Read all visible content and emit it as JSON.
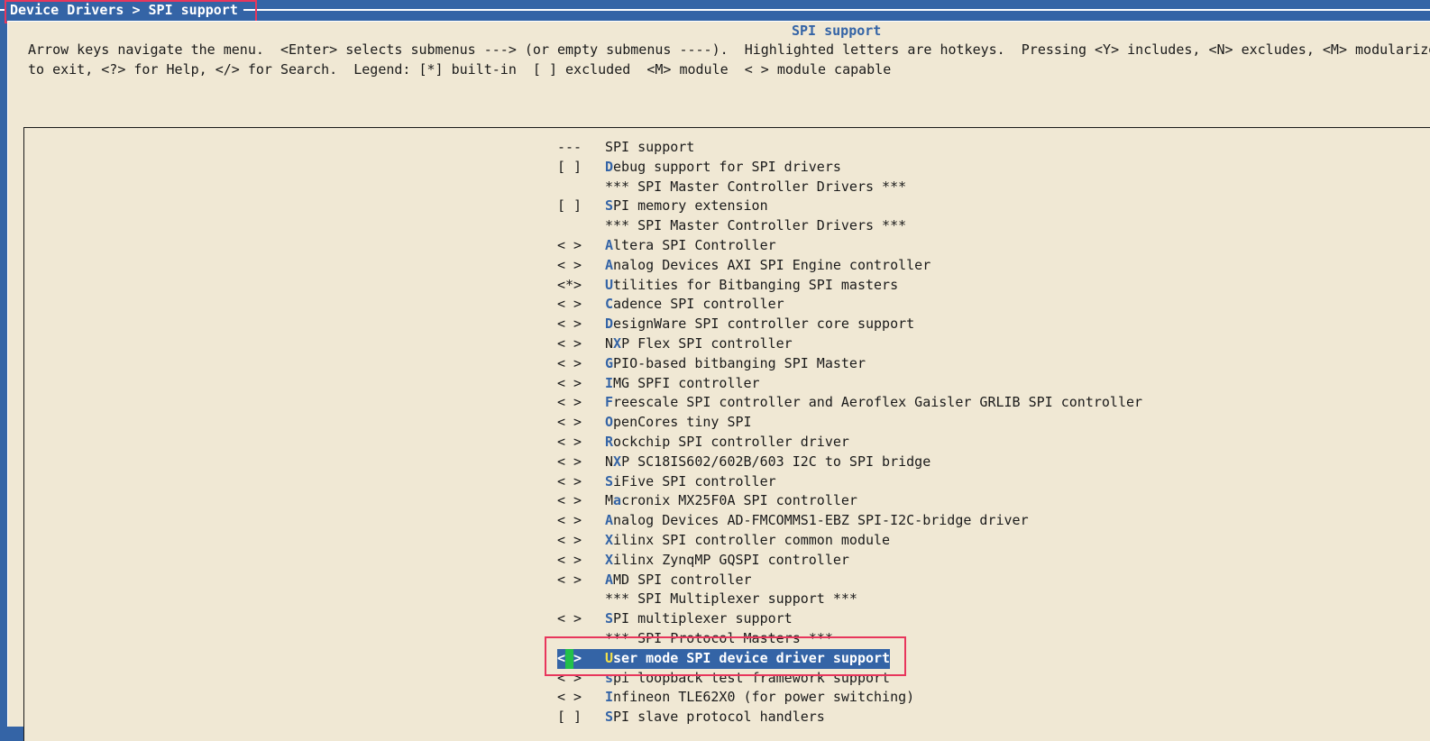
{
  "breadcrumb": "Device Drivers > SPI support",
  "panel_title": "SPI support",
  "help_lines": [
    "Arrow keys navigate the menu.  <Enter> selects submenus ---> (or empty submenus ----).  Highlighted letters are hotkeys.  Pressing <Y> includes, <N> excludes, <M> modularize",
    "to exit, <?> for Help, </> for Search.  Legend: [*] built-in  [ ] excluded  <M> module  < > module capable"
  ],
  "colors": {
    "blue": "#3464a6",
    "panel": "#f0e8d4",
    "highlight_border": "#e8365c"
  },
  "menu": [
    {
      "mark": "---",
      "hot": "",
      "rest": "SPI support"
    },
    {
      "mark": "[ ]",
      "hot": "D",
      "rest": "ebug support for SPI drivers"
    },
    {
      "mark": "",
      "hot": "",
      "rest": "*** SPI Master Controller Drivers ***"
    },
    {
      "mark": "[ ]",
      "hot": "S",
      "rest": "PI memory extension"
    },
    {
      "mark": "",
      "hot": "",
      "rest": "*** SPI Master Controller Drivers ***"
    },
    {
      "mark": "< >",
      "hot": "A",
      "rest": "ltera SPI Controller"
    },
    {
      "mark": "< >",
      "hot": "A",
      "rest": "nalog Devices AXI SPI Engine controller"
    },
    {
      "mark": "<*>",
      "hot": "U",
      "rest": "tilities for Bitbanging SPI masters"
    },
    {
      "mark": "< >",
      "hot": "C",
      "rest": "adence SPI controller"
    },
    {
      "mark": "< >",
      "hot": "D",
      "rest": "esignWare SPI controller core support"
    },
    {
      "mark": "< >",
      "pre": "N",
      "hot": "X",
      "rest": "P Flex SPI controller"
    },
    {
      "mark": "< >",
      "hot": "G",
      "rest": "PIO-based bitbanging SPI Master"
    },
    {
      "mark": "< >",
      "hot": "I",
      "rest": "MG SPFI controller"
    },
    {
      "mark": "< >",
      "hot": "F",
      "rest": "reescale SPI controller and Aeroflex Gaisler GRLIB SPI controller"
    },
    {
      "mark": "< >",
      "hot": "O",
      "rest": "penCores tiny SPI"
    },
    {
      "mark": "< >",
      "hot": "R",
      "rest": "ockchip SPI controller driver"
    },
    {
      "mark": "< >",
      "pre": "N",
      "hot": "X",
      "rest": "P SC18IS602/602B/603 I2C to SPI bridge"
    },
    {
      "mark": "< >",
      "hot": "S",
      "rest": "iFive SPI controller"
    },
    {
      "mark": "< >",
      "pre": "M",
      "hot": "a",
      "rest": "cronix MX25F0A SPI controller"
    },
    {
      "mark": "< >",
      "hot": "A",
      "rest": "nalog Devices AD-FMCOMMS1-EBZ SPI-I2C-bridge driver"
    },
    {
      "mark": "< >",
      "hot": "X",
      "rest": "ilinx SPI controller common module"
    },
    {
      "mark": "< >",
      "hot": "X",
      "rest": "ilinx ZynqMP GQSPI controller"
    },
    {
      "mark": "< >",
      "hot": "A",
      "rest": "MD SPI controller"
    },
    {
      "mark": "",
      "hot": "",
      "rest": "*** SPI Multiplexer support ***"
    },
    {
      "mark": "< >",
      "hot": "S",
      "rest": "PI multiplexer support"
    },
    {
      "mark": "",
      "hot": "",
      "rest": "*** SPI Protocol Masters ***"
    },
    {
      "mark": "< >",
      "hot": "U",
      "rest": "ser mode SPI device driver support",
      "selected": true
    },
    {
      "mark": "< >",
      "hot": "s",
      "rest": "pi loopback test framework support"
    },
    {
      "mark": "< >",
      "hot": "I",
      "rest": "nfineon TLE62X0 (for power switching)"
    },
    {
      "mark": "[ ]",
      "hot": "S",
      "rest": "PI slave protocol handlers"
    }
  ]
}
